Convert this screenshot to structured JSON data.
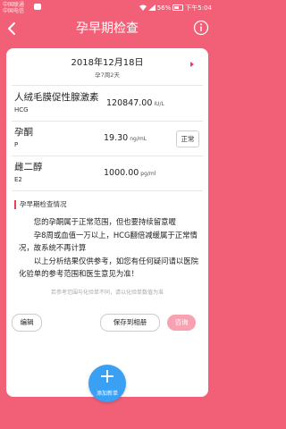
{
  "status_bar": {
    "carrier_1": "中国联通",
    "carrier_2": "中国电信",
    "battery": "56%",
    "time": "下午5:04"
  },
  "nav": {
    "title": "孕早期检查"
  },
  "record": {
    "date": "2018年12月18日",
    "gestation": "孕7周2天"
  },
  "metrics": [
    {
      "name": "人绒毛膜促性腺激素",
      "code": "HCG",
      "value": "120847.00",
      "unit": "IU/L",
      "status": ""
    },
    {
      "name": "孕酮",
      "code": "P",
      "value": "19.30",
      "unit": "ng/mL",
      "status": "正常"
    },
    {
      "name": "雌二醇",
      "code": "E2",
      "value": "1000.00",
      "unit": "pg/ml",
      "status": ""
    }
  ],
  "analysis": {
    "title": "孕早期检查情况",
    "paragraphs": [
      "您的孕酮属于正常范围，但也要持续留意喔",
      "孕8周或血值一万以上，HCG翻倍减缓属于正常情况，故系统不再计算",
      "以上分析结果仅供参考，如您有任何疑问请以医院化验单的参考范围和医生意见为准！"
    ],
    "disclaimer": "若参考范围与化验单不同，请以化验单数值为准"
  },
  "buttons": {
    "edit": "编辑",
    "save": "保存到相册",
    "consult": "咨询"
  },
  "fab": {
    "label": "添加新单"
  },
  "colors": {
    "background": "#f26077",
    "accent": "#e8405c",
    "fab": "#3aa0f3",
    "consult": "#f7a1b1"
  }
}
